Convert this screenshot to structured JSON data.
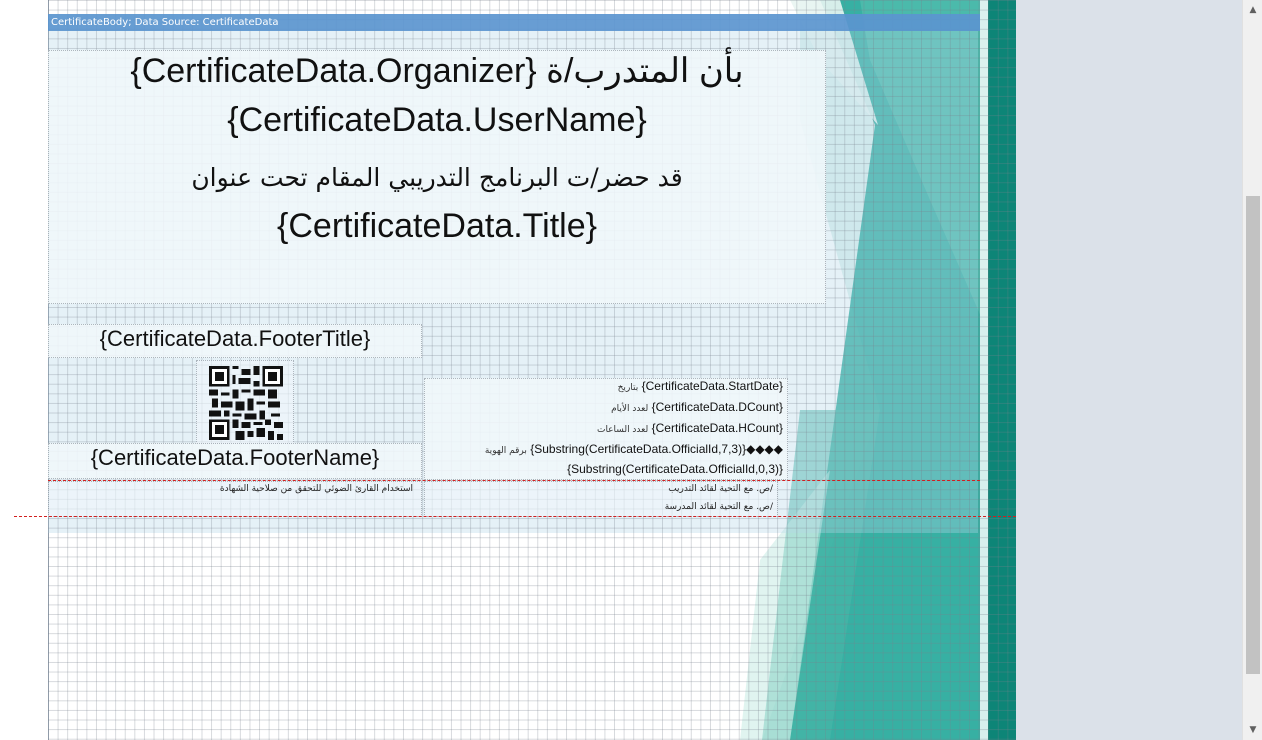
{
  "section_header": "CertificateBody; Data Source: CertificateData",
  "main_block": {
    "line1": "{CertificateData.Organizer} بأن المتدرب/ة",
    "line2": "{CertificateData.UserName}",
    "line3": "قد حضر/ت البرنامج التدريبي المقام تحت عنوان",
    "line4": "{CertificateData.Title}"
  },
  "footer_title": "{CertificateData.FooterTitle}",
  "footer_name": "{CertificateData.FooterName}",
  "qr_note": "استخدام القارئ الضوئي للتحقق من صلاحية الشهادة",
  "details": {
    "start_date": {
      "field": "{CertificateData.StartDate}",
      "label": "بتاريخ"
    },
    "day_count": {
      "field": "{CertificateData.DCount}",
      "label": "لعدد الأيام"
    },
    "hour_count": {
      "field": "{CertificateData.HCount}",
      "label": "لعدد الساعات"
    },
    "official_1": {
      "field": "{Substring(CertificateData.OfficialId,7,3)}◆◆◆◆",
      "label": "برقم الهوية"
    },
    "official_2": {
      "field": "{Substring(CertificateData.OfficialId,0,3)}"
    }
  },
  "signatures": {
    "line1": "ص. مع التحية لقائد التدريب/",
    "line2": "ص. مع التحية لقائد المدرسة/"
  },
  "colors": {
    "teal": "#1aa595",
    "teal_dark": "#0d8577",
    "header_blue": "#5b95cf",
    "guide_red": "#d21f1f"
  },
  "icons": {
    "qr": "qr-code-icon",
    "scroll_up": "chevron-up-icon",
    "scroll_down": "chevron-down-icon"
  }
}
